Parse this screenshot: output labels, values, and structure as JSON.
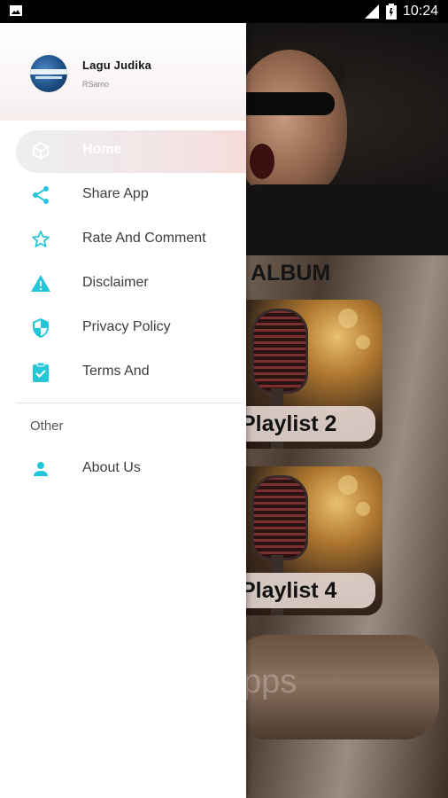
{
  "status_bar": {
    "time": "10:24"
  },
  "background_app": {
    "section_title": "ALBUM",
    "playlists": [
      {
        "label": "Playlist 2"
      },
      {
        "label": "Playlist 4"
      }
    ],
    "apps_card_text": "pps"
  },
  "drawer": {
    "app_name": "Lagu Judika",
    "developer": "RSamo",
    "items": [
      {
        "label": "Home",
        "icon": "cube-icon"
      },
      {
        "label": "Share App",
        "icon": "share-icon"
      },
      {
        "label": "Rate And Comment",
        "icon": "star-icon"
      },
      {
        "label": "Disclaimer",
        "icon": "warning-icon"
      },
      {
        "label": "Privacy Policy",
        "icon": "shield-icon"
      },
      {
        "label": "Terms And",
        "icon": "clipboard-check-icon"
      }
    ],
    "section_label": "Other",
    "other_items": [
      {
        "label": "About Us",
        "icon": "person-icon"
      }
    ]
  },
  "colors": {
    "accent": "#26C6DA",
    "drawer_bg": "#FFFFFF",
    "text": "#3D3D3D"
  }
}
